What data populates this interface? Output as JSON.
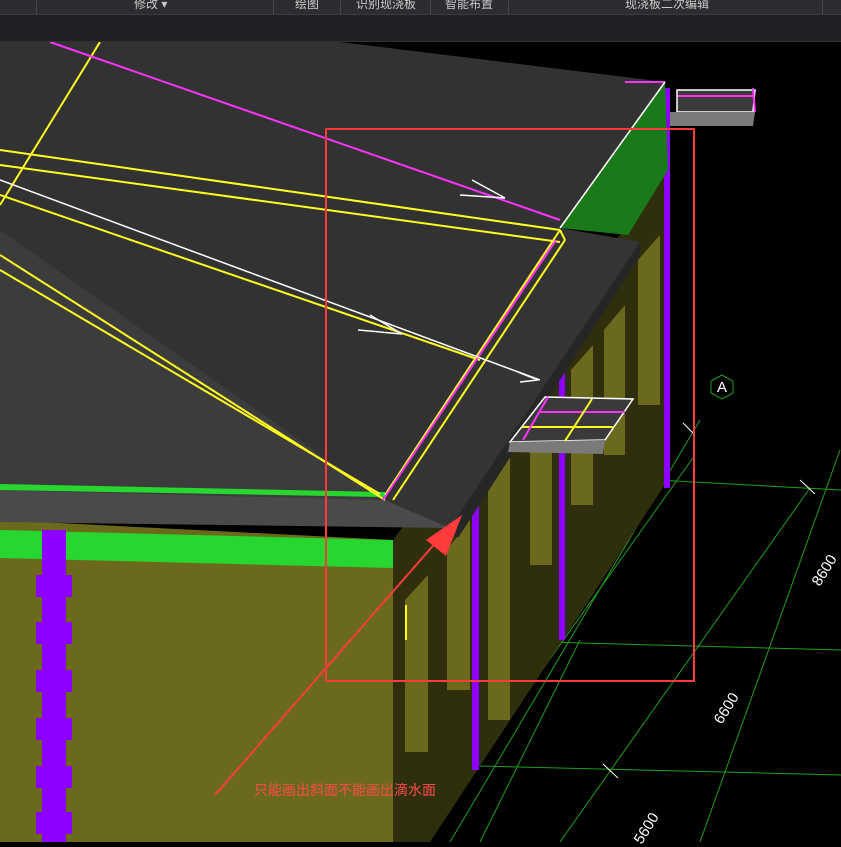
{
  "toolbar": {
    "items": [
      {
        "label": "修改",
        "dropdown": "▾"
      },
      {
        "label": "绘图"
      },
      {
        "label": "识别现浇板"
      },
      {
        "label": "智能布置"
      },
      {
        "label": "现浇板二次编辑"
      }
    ]
  },
  "viewport": {
    "annotation_text": "只能画出斜面不能画出滴水面",
    "axis_label": "A",
    "dimensions": [
      "8600",
      "6600",
      "5600"
    ],
    "colors": {
      "slab": "#323232",
      "wall": "#6b6a1c",
      "beam": "#27d62f",
      "column": "#8d00ff",
      "edge_yellow": "#ffff22",
      "magenta_line": "#ff33ff",
      "highlight_box": "#ff3b3b",
      "grid": "#1d9e1d"
    }
  }
}
